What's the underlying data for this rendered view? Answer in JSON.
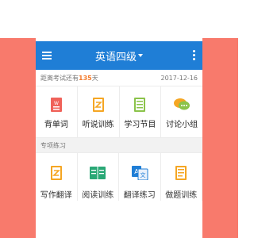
{
  "appbar": {
    "title": "英语四级",
    "icons": {
      "menu": "hamburger-icon",
      "more": "more-vertical-icon"
    }
  },
  "countdown": {
    "prefix": "距离考试还有",
    "days": "135",
    "suffix": "天",
    "date": "2017-12-16"
  },
  "main_grid": [
    {
      "label": "背单词",
      "icon": "vocabulary-book-icon",
      "color": "#f0625a"
    },
    {
      "label": "听说训练",
      "icon": "listening-document-icon",
      "color": "#f5a623"
    },
    {
      "label": "学习节目",
      "icon": "program-list-icon",
      "color": "#8bc34a"
    },
    {
      "label": "讨论小组",
      "icon": "chat-bubble-icon",
      "color": "#f5a623"
    }
  ],
  "section": {
    "title": "专项练习"
  },
  "practice_grid": [
    {
      "label": "写作翻译",
      "icon": "writing-document-icon",
      "color": "#f5a623"
    },
    {
      "label": "阅读训练",
      "icon": "reading-book-icon",
      "color": "#2aa876"
    },
    {
      "label": "翻译练习",
      "icon": "translate-icon",
      "color": "#1f7ed6"
    },
    {
      "label": "做题训练",
      "icon": "exercise-note-icon",
      "color": "#f5a623"
    }
  ],
  "colors": {
    "primary": "#1f7ed6",
    "accent": "#f47a2a",
    "side": "#f87a6c"
  }
}
